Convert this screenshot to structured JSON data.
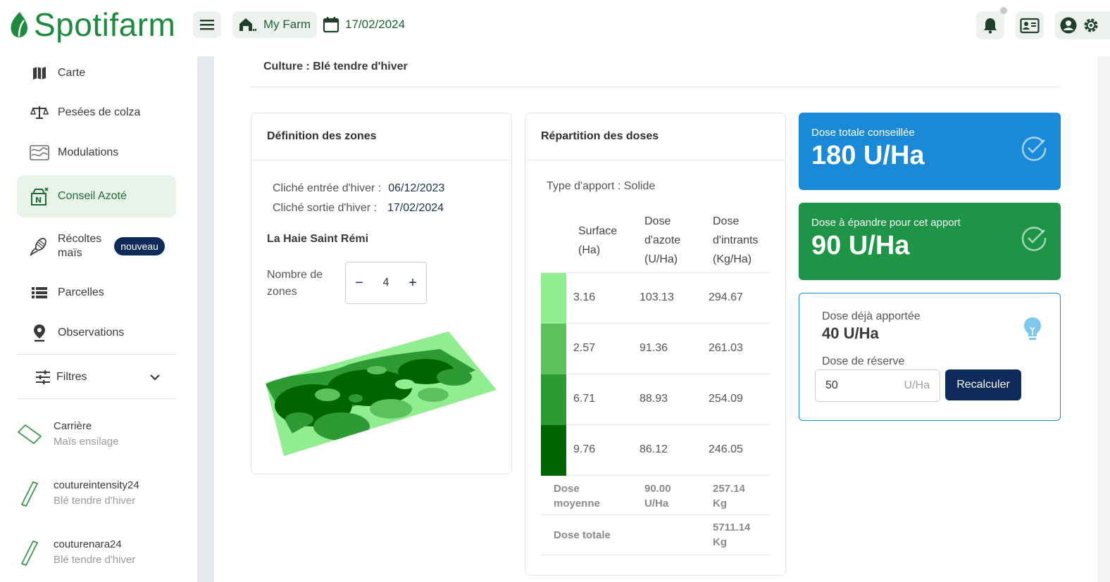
{
  "app": {
    "name": "Spotifarm"
  },
  "header": {
    "farm_label": "My Farm",
    "date_label": "17/02/2024"
  },
  "sidebar": {
    "items": [
      {
        "label": "Carte",
        "icon": "map-icon"
      },
      {
        "label": "Pesées de colza",
        "icon": "scale-icon"
      },
      {
        "label": "Modulations",
        "icon": "modulation-icon"
      },
      {
        "label": "Conseil Azoté",
        "icon": "nitrogen-icon",
        "active": true
      },
      {
        "label_line1": "Récoltes",
        "label_line2": "maïs",
        "badge": "nouveau",
        "icon": "corn-icon"
      },
      {
        "label": "Parcelles",
        "icon": "list-icon"
      },
      {
        "label": "Observations",
        "icon": "location-pin-icon"
      }
    ],
    "filters_label": "Filtres",
    "fields": [
      {
        "name": "Carrière",
        "crop": "Maïs ensilage"
      },
      {
        "name": "coutureintensity24",
        "crop": "Blé tendre d'hiver"
      },
      {
        "name": "couturenara24",
        "crop": "Blé tendre d'hiver"
      }
    ]
  },
  "main": {
    "culture": "Culture : Blé tendre d'hiver",
    "zones_card": {
      "title": "Définition des zones",
      "entry_label": "Cliché entrée d'hiver :",
      "entry_value": "06/12/2023",
      "exit_label": "Cliché sortie d'hiver :",
      "exit_value": "17/02/2024",
      "parcel_name": "La Haie Saint Rémi",
      "zones_label": "Nombre de zones",
      "zones_count": "4",
      "minus": "−",
      "plus": "+"
    },
    "doses_card": {
      "title": "Répartition des doses",
      "type_apport": "Type d'apport : Solide",
      "headers": [
        [
          "Surface",
          "(Ha)"
        ],
        [
          "Dose",
          "d'azote",
          "(U/Ha)"
        ],
        [
          "Dose",
          "d'intrants",
          "(Kg/Ha)"
        ]
      ],
      "rows": [
        {
          "color": "#90ee90",
          "surface": "3.16",
          "azote": "103.13",
          "intrants": "294.67"
        },
        {
          "color": "#5cc05c",
          "surface": "2.57",
          "azote": "91.36",
          "intrants": "261.03"
        },
        {
          "color": "#2e9a34",
          "surface": "6.71",
          "azote": "88.93",
          "intrants": "254.09"
        },
        {
          "color": "#006400",
          "surface": "9.76",
          "azote": "86.12",
          "intrants": "246.05"
        }
      ],
      "avg": {
        "label1": "Dose",
        "label2": "moyenne",
        "azote1": "90.00",
        "azote2": "U/Ha",
        "intrants1": "257.14",
        "intrants2": "Kg"
      },
      "total": {
        "label": "Dose totale",
        "intrants1": "5711.14",
        "intrants2": "Kg"
      }
    },
    "panels": {
      "total": {
        "label": "Dose totale conseillée",
        "value": "180 U/Ha",
        "color": "#1a8ad8"
      },
      "apply": {
        "label": "Dose à épandre pour cet apport",
        "value": "90 U/Ha",
        "color": "#1e9447"
      },
      "reserve_box": {
        "applied_label": "Dose déjà apportée",
        "applied_value": "40 U/Ha",
        "reserve_label": "Dose de réserve",
        "reserve_value": "50",
        "reserve_unit": "U/Ha",
        "recalc_label": "Recalculer"
      }
    }
  }
}
